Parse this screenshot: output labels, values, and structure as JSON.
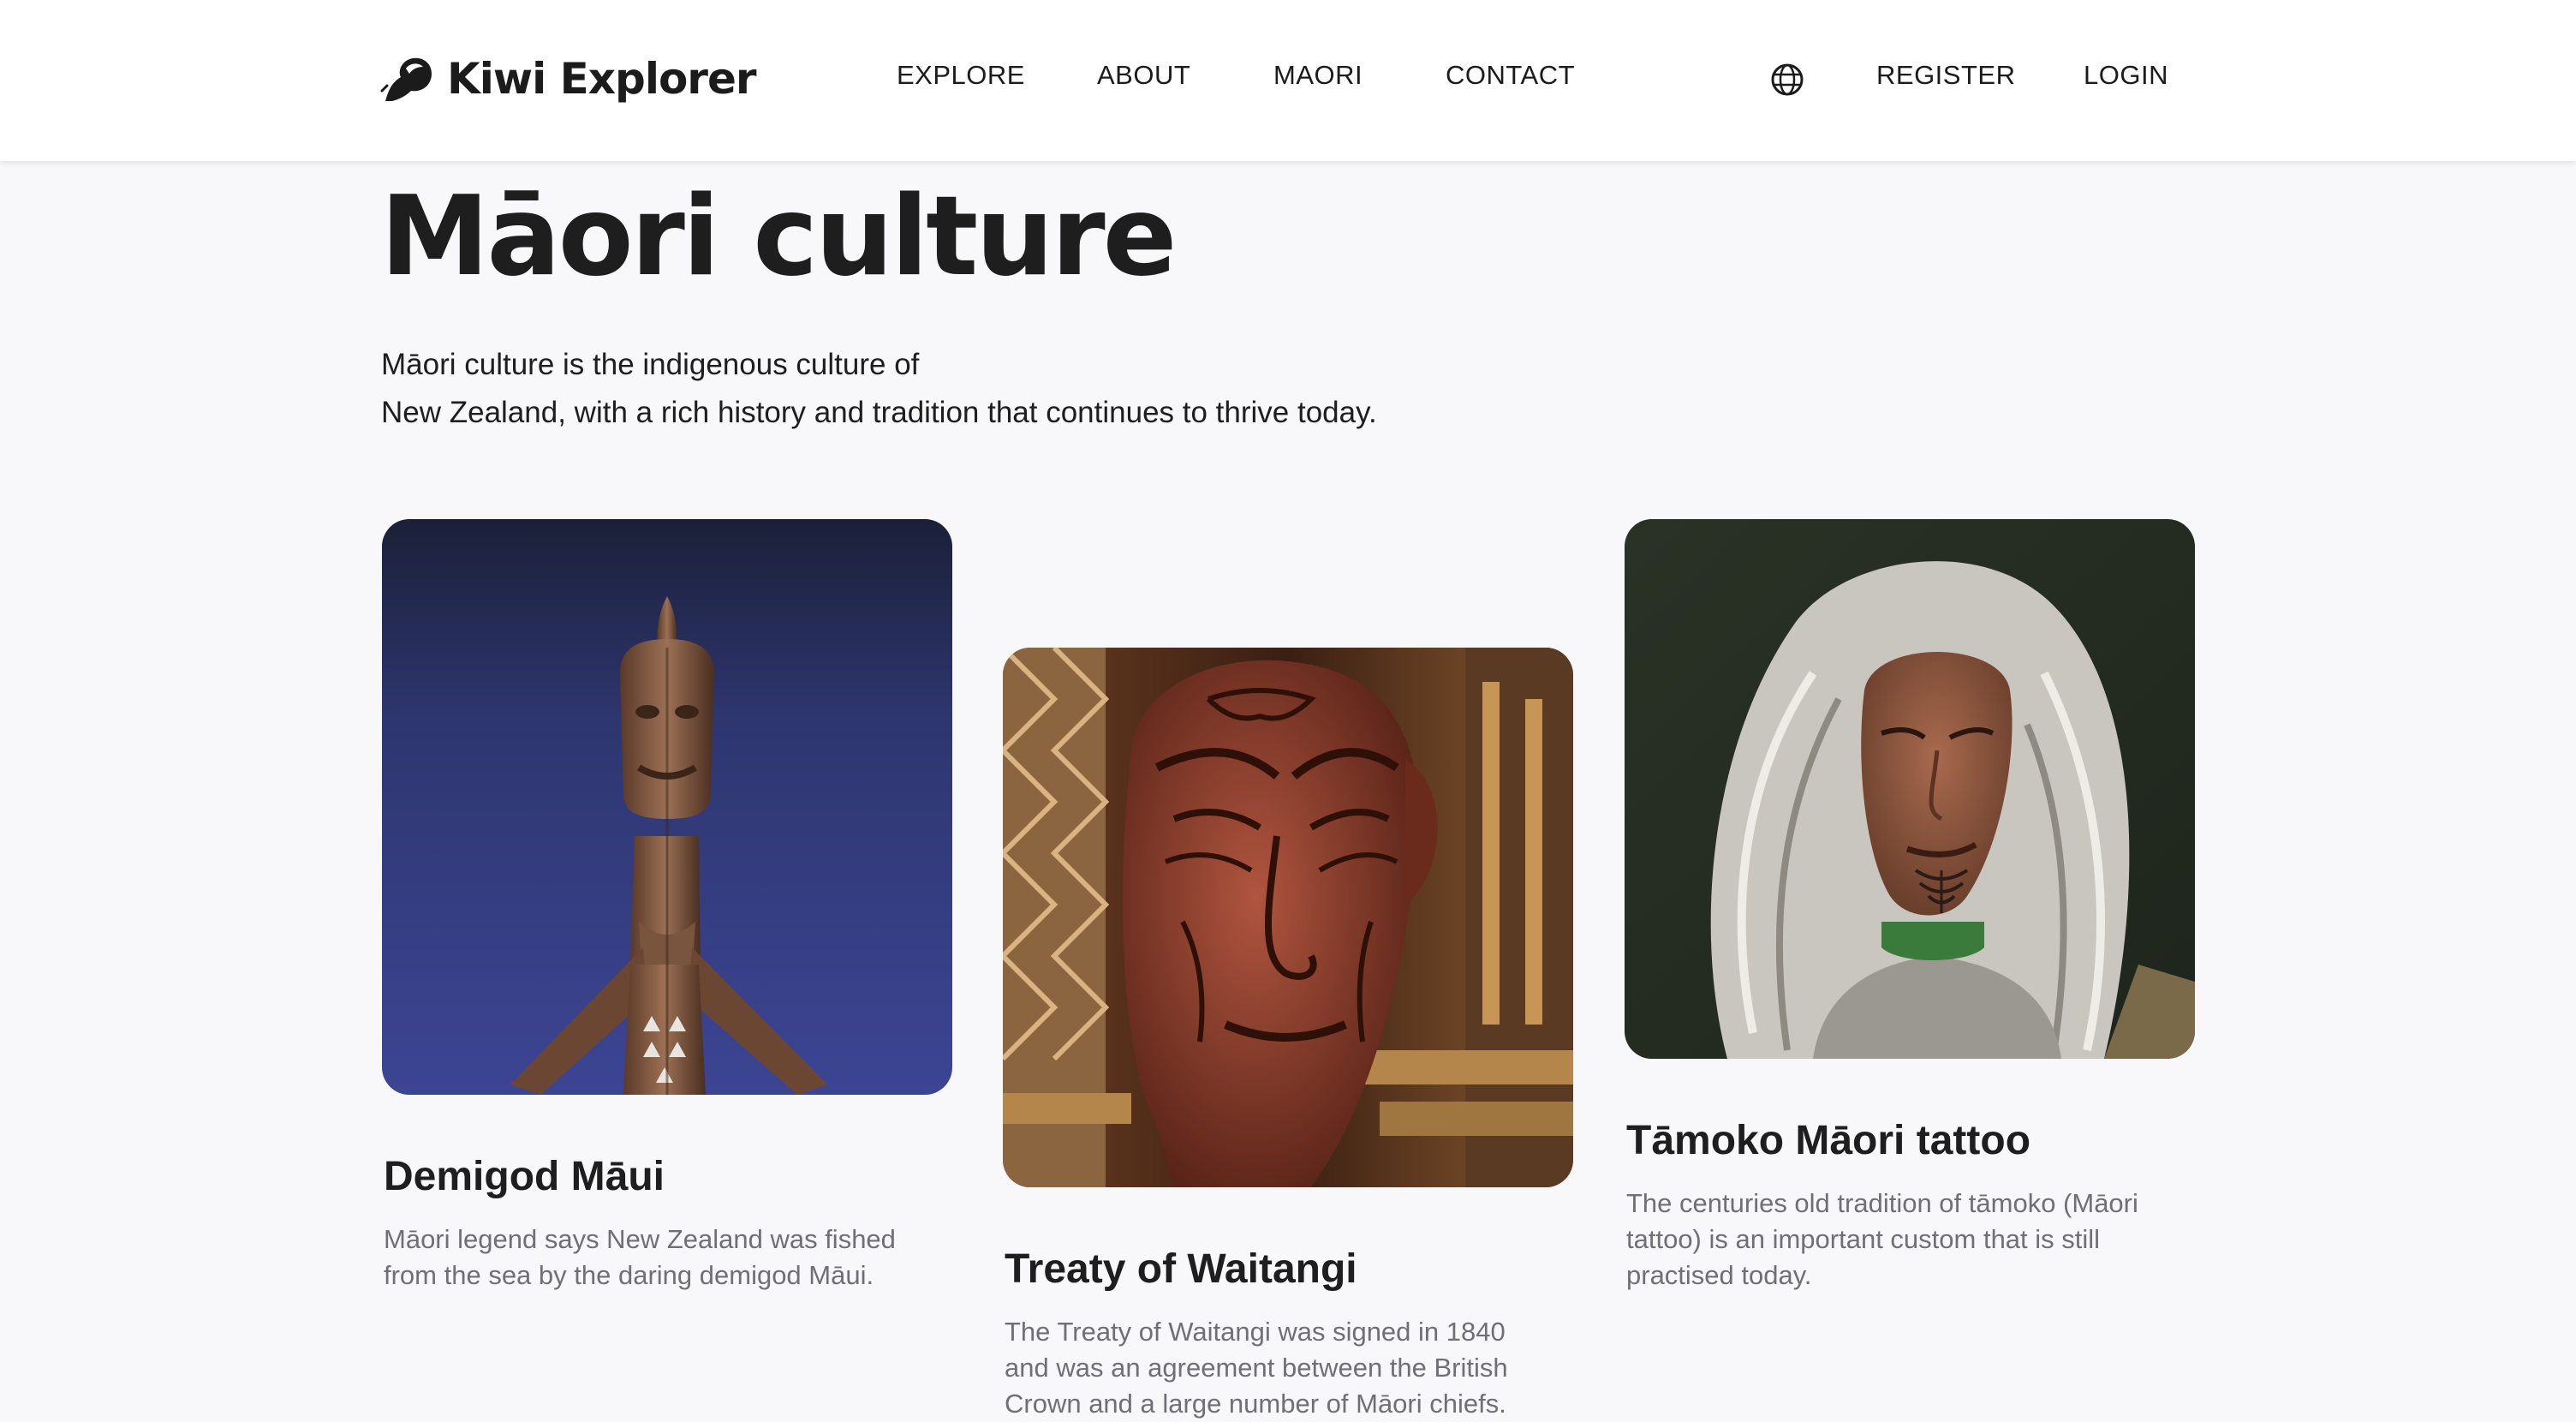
{
  "brand": {
    "name": "Kiwi Explorer",
    "logo_icon": "kiwi-bird-icon"
  },
  "nav": {
    "items": [
      {
        "label": "EXPLORE"
      },
      {
        "label": "ABOUT"
      },
      {
        "label": "MAORI"
      },
      {
        "label": "CONTACT"
      }
    ],
    "language_icon": "globe-icon",
    "register_label": "REGISTER",
    "login_label": "LOGIN"
  },
  "hero": {
    "title": "Māori culture",
    "intro_line1": "Māori culture is the indigenous culture of",
    "intro_line2": "New Zealand, with a rich history and tradition that continues to thrive today."
  },
  "cards": [
    {
      "title": "Demigod Māui",
      "description": "Māori legend says New Zealand was fished from the sea by the daring demigod Māui.",
      "image": "carved-wooden-pou-against-night-sky"
    },
    {
      "title": "Treaty of Waitangi",
      "description": "The Treaty of Waitangi was signed in 1840 and was an agreement between the British Crown and a large number of Māori chiefs.",
      "image": "carved-wooden-head-in-meeting-house"
    },
    {
      "title": "Tāmoko Māori tattoo",
      "description": "The centuries old tradition of tāmoko (Māori tattoo) is an important custom that is still practised today.",
      "image": "elder-woman-with-moko-kauae"
    }
  ],
  "colors": {
    "background": "#f8f8fa",
    "header": "#ffffff",
    "text": "#1e1e1e",
    "muted_text": "#6f6f75"
  }
}
